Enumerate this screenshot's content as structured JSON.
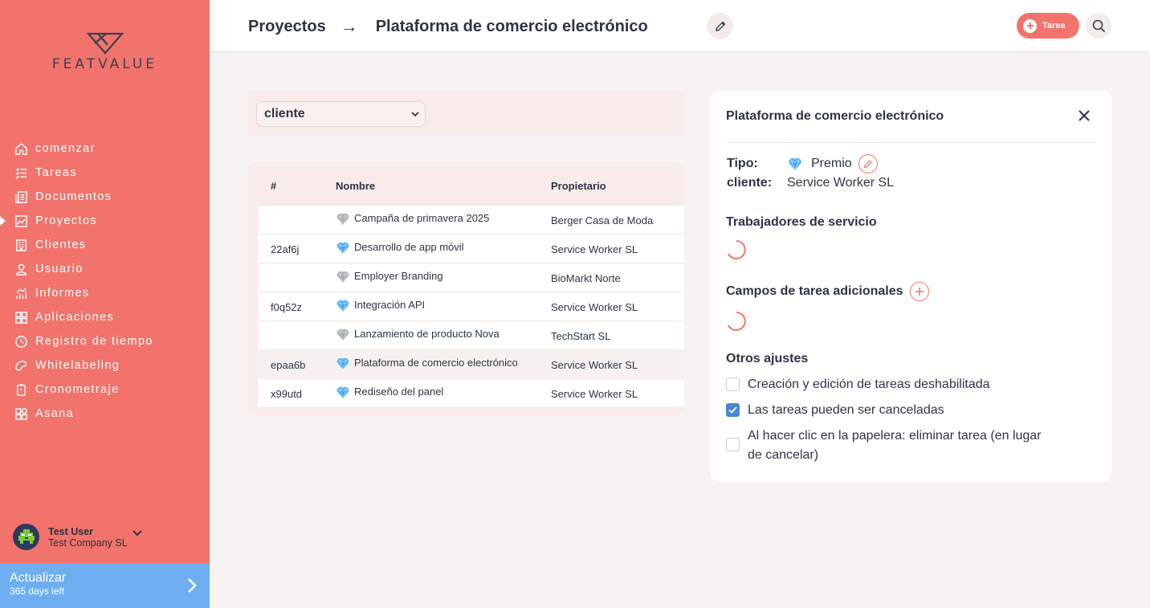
{
  "brand": {
    "name": "FEATVALUE"
  },
  "sidebar": {
    "items": [
      {
        "label": "comenzar",
        "icon": "home-icon"
      },
      {
        "label": "Tareas",
        "icon": "tasks-icon"
      },
      {
        "label": "Documentos",
        "icon": "documents-icon"
      },
      {
        "label": "Proyectos",
        "icon": "projects-icon",
        "active": true
      },
      {
        "label": "Clientes",
        "icon": "clients-icon"
      },
      {
        "label": "Usuario",
        "icon": "user-icon"
      },
      {
        "label": "Informes",
        "icon": "reports-icon"
      },
      {
        "label": "Aplicaciones",
        "icon": "apps-icon"
      },
      {
        "label": "Registro de tiempo",
        "icon": "clock-icon"
      },
      {
        "label": "Whitelabeling",
        "icon": "whitelabel-icon"
      },
      {
        "label": "Cronometraje",
        "icon": "timer-icon"
      },
      {
        "label": "Asana",
        "icon": "asana-icon"
      }
    ],
    "user": {
      "name": "Test User",
      "company": "Test Company SL"
    },
    "upgrade": {
      "title": "Actualizar",
      "subtitle": "365 days left"
    }
  },
  "header": {
    "breadcrumb_root": "Proyectos",
    "arrow": "→",
    "breadcrumb_current": "Plataforma de comercio electrónico",
    "task_button": "Tarea"
  },
  "filter": {
    "selected": "cliente"
  },
  "table": {
    "columns": [
      "#",
      "Nombre",
      "Propietario"
    ],
    "rows": [
      {
        "id": "",
        "gem": "silver",
        "name": "Campaña de primavera 2025",
        "owner": "Berger Casa de Moda"
      },
      {
        "id": "22af6j",
        "gem": "blue",
        "name": "Desarrollo de app móvil",
        "owner": "Service Worker SL"
      },
      {
        "id": "",
        "gem": "silver",
        "name": "Employer Branding",
        "owner": "BioMarkt Norte"
      },
      {
        "id": "f0q52z",
        "gem": "blue",
        "name": "Integración API",
        "owner": "Service Worker SL"
      },
      {
        "id": "",
        "gem": "silver",
        "name": "Lanzamiento de producto Nova",
        "owner": "TechStart SL"
      },
      {
        "id": "epaa6b",
        "gem": "blue",
        "name": "Plataforma de comercio electrónico",
        "owner": "Service Worker SL",
        "selected": true
      },
      {
        "id": "x99utd",
        "gem": "blue",
        "name": "Rediseño del panel",
        "owner": "Service Worker SL"
      }
    ]
  },
  "panel": {
    "title": "Plataforma de comercio electrónico",
    "type_label": "Tipo:",
    "type_value": "Premio",
    "client_label": "cliente:",
    "client_value": "Service Worker SL",
    "service_workers_title": "Trabajadores de servicio",
    "extra_fields_title": "Campos de tarea adicionales",
    "other_settings_title": "Otros ajustes",
    "settings": [
      {
        "label": "Creación y edición de tareas deshabilitada",
        "checked": false
      },
      {
        "label": "Las tareas pueden ser canceladas",
        "checked": true
      },
      {
        "label_line1": "Al hacer clic en la papelera: eliminar tarea (en lugar",
        "label_line2": "de cancelar)",
        "checked": false
      }
    ]
  },
  "colors": {
    "accent": "#f2736b",
    "upgrade": "#6eaef0",
    "checkbox": "#4c86d4",
    "text": "#2e3446"
  }
}
